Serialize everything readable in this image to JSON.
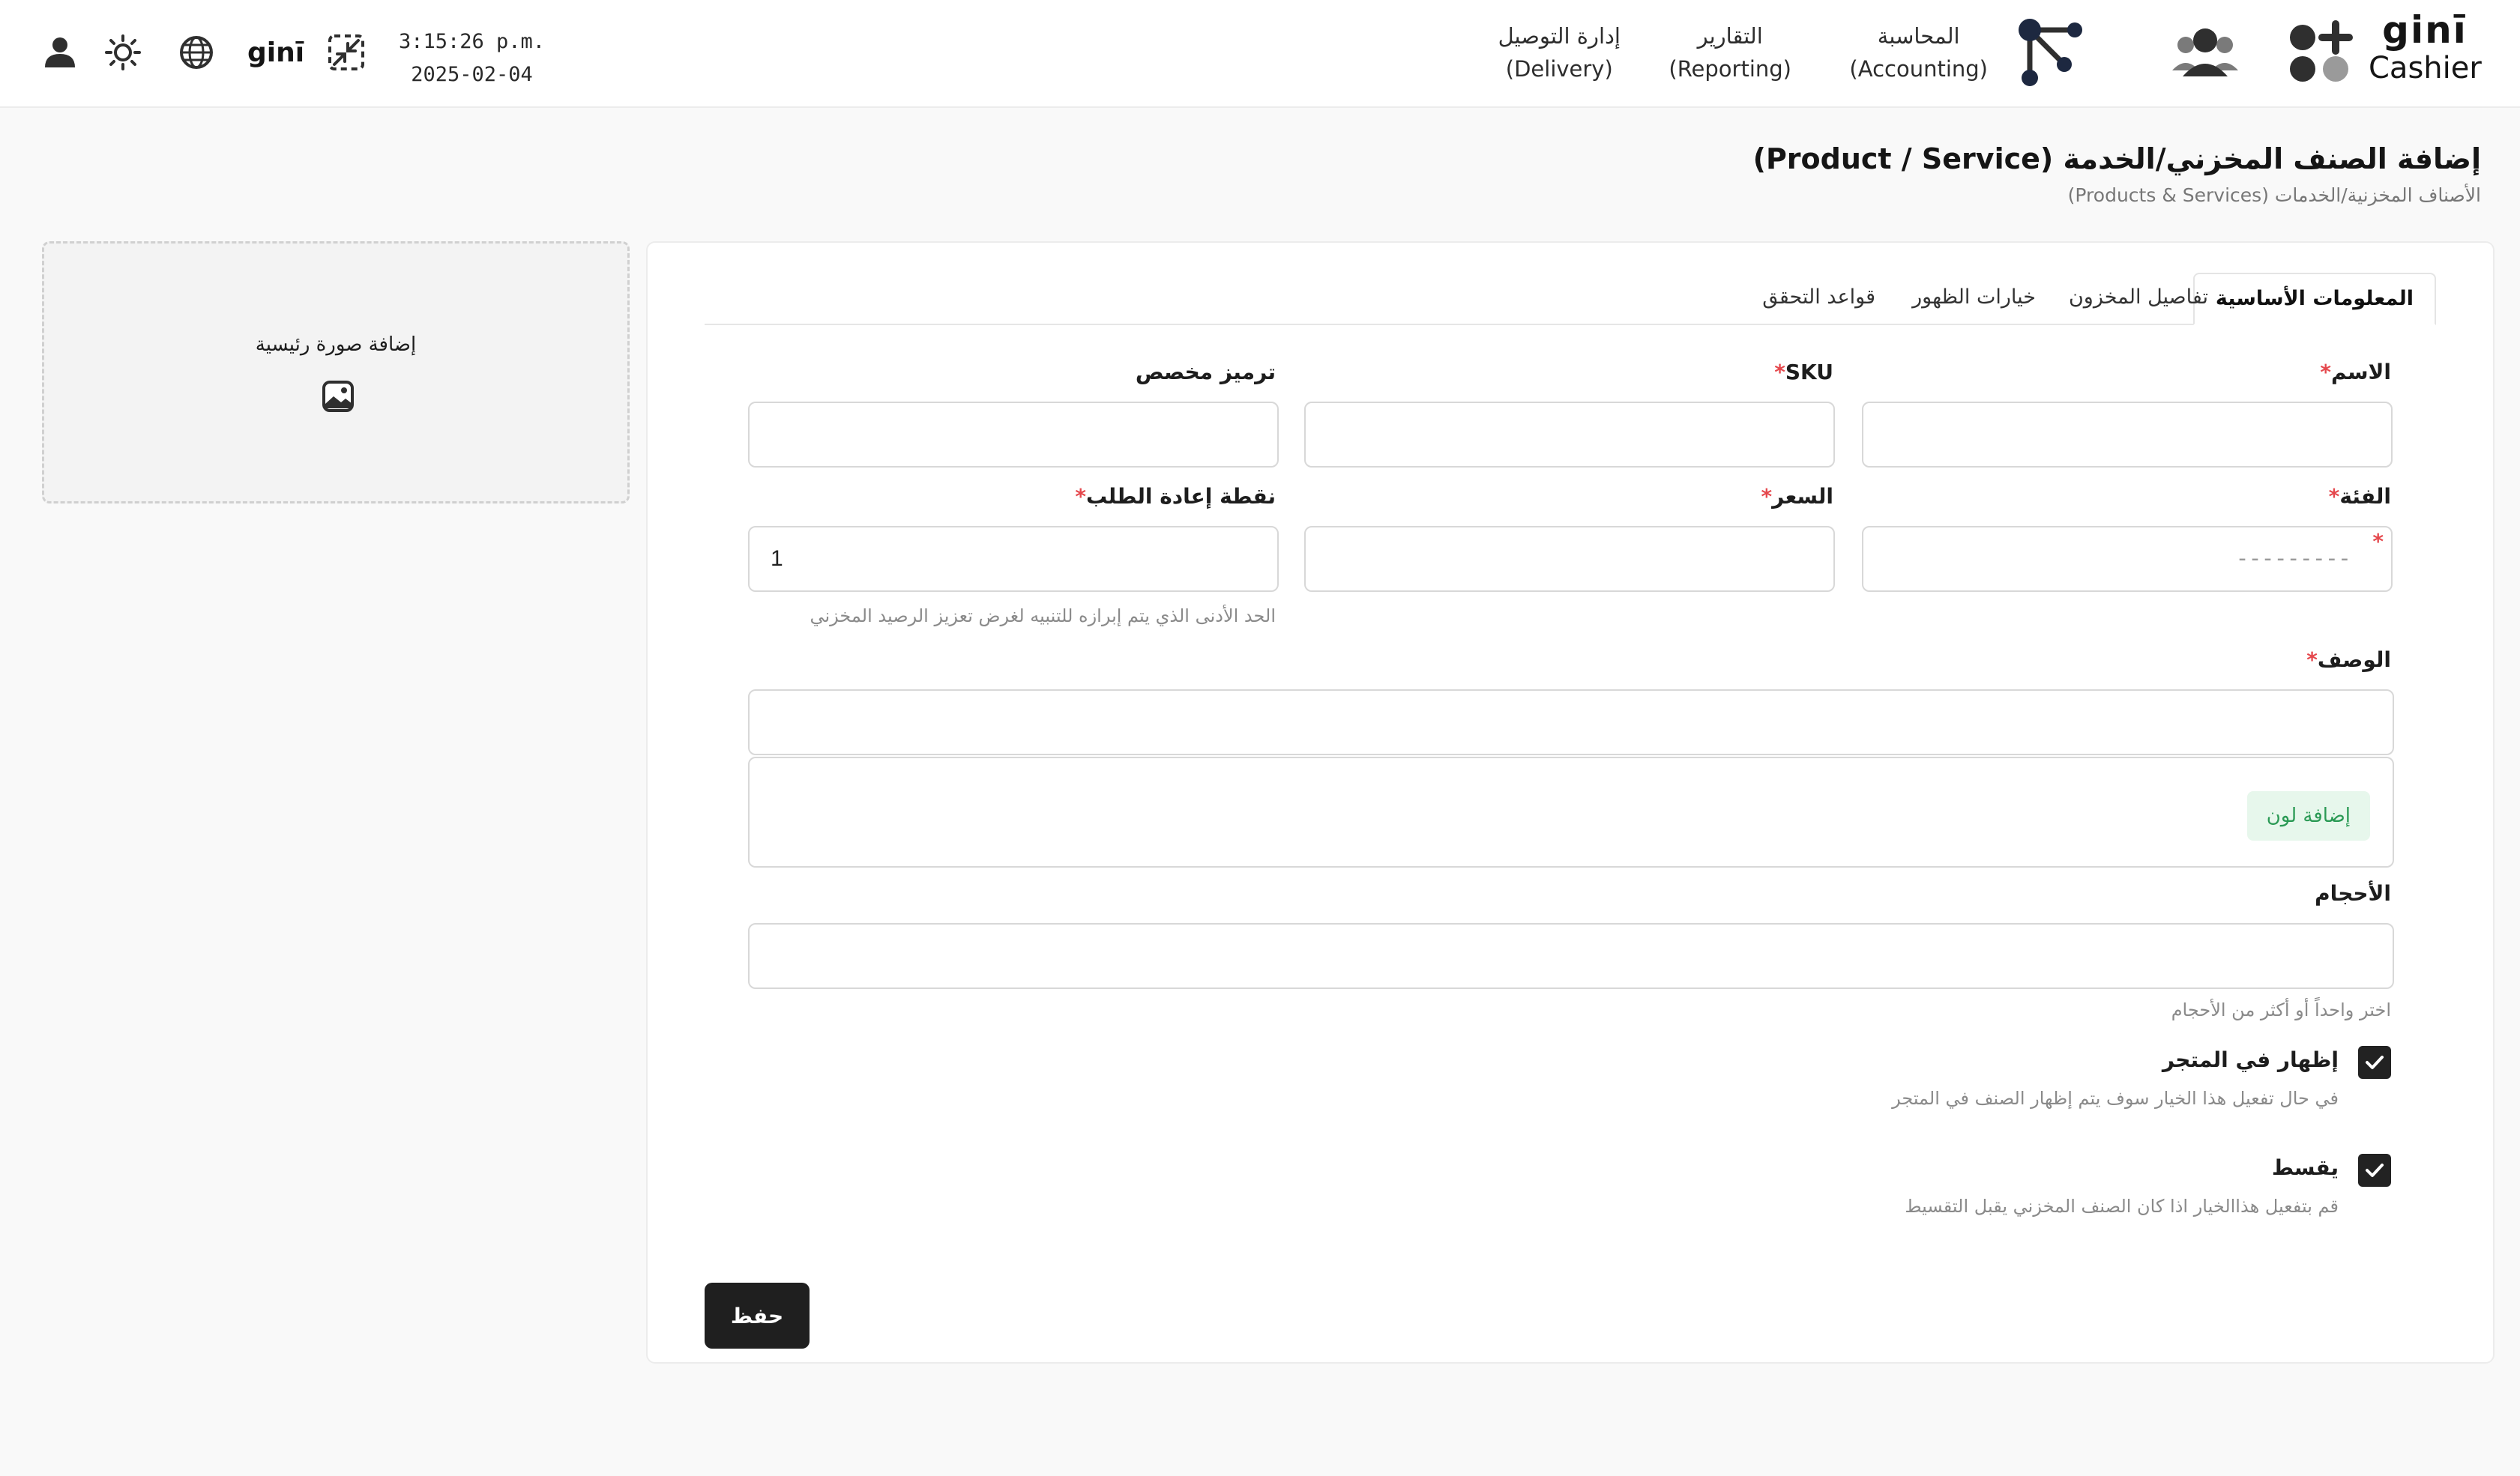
{
  "header": {
    "logo_mark": "ginī",
    "logo_text": "Cashier",
    "nav": [
      {
        "title": "المحاسبة",
        "subtitle": "(Accounting)"
      },
      {
        "title": "التقارير",
        "subtitle": "(Reporting)"
      },
      {
        "title": "إدارة التوصيل",
        "subtitle": "(Delivery)"
      }
    ],
    "clock_time": "3:15:26 p.m.",
    "clock_date": "2025-02-04",
    "mini_logo": "ginī",
    "icons": [
      "add-apps-icon",
      "users-icon",
      "workflow-icon",
      "exit-fullscreen-icon",
      "globe-icon",
      "sun-icon",
      "user-icon"
    ]
  },
  "page": {
    "title": "إضافة الصنف المخزني/الخدمة (Product / Service)",
    "breadcrumb": "الأصناف المخزنية/الخدمات (Products & Services)"
  },
  "image_card": {
    "label": "إضافة صورة رئيسية"
  },
  "tabs": [
    {
      "label": "المعلومات الأساسية",
      "active": true
    },
    {
      "label": "تفاصيل المخزون",
      "active": false
    },
    {
      "label": "خيارات الظهور",
      "active": false
    },
    {
      "label": "قواعد التحقق",
      "active": false
    }
  ],
  "form": {
    "name_label": "الاسم",
    "sku_label": "SKU",
    "custom_code_label": "ترميز مخصص",
    "category_label": "الفئة",
    "category_value": "---------",
    "price_label": "السعر",
    "reorder_label": "نقطة إعادة الطلب",
    "reorder_value": "1",
    "reorder_hint": "الحد الأدنى الذي يتم إبرازه للتنبيه لغرض تعزيز الرصيد المخزني",
    "description_label": "الوصف",
    "add_color_label": "إضافة لون",
    "sizes_label": "الأحجام",
    "sizes_hint": "اختر واحداً أو أكثر من الأحجام",
    "required_mark": "*",
    "show_in_store_label": "إظهار في المتجر",
    "show_in_store_hint": "في حال تفعيل هذا الخيار سوف يتم إظهار الصنف في المتجر",
    "show_in_store_checked": true,
    "installment_label": "يقسط",
    "installment_hint": "قم بتفعيل هذاالخيار اذا كان الصنف المخزني يقبل التقسيط",
    "installment_checked": true,
    "save_label": "حفظ"
  },
  "colors": {
    "accent_red": "#e5484d",
    "add_color_bg": "#e7f7ec",
    "add_color_text": "#2b9a55",
    "primary_button": "#1f1f1f"
  }
}
